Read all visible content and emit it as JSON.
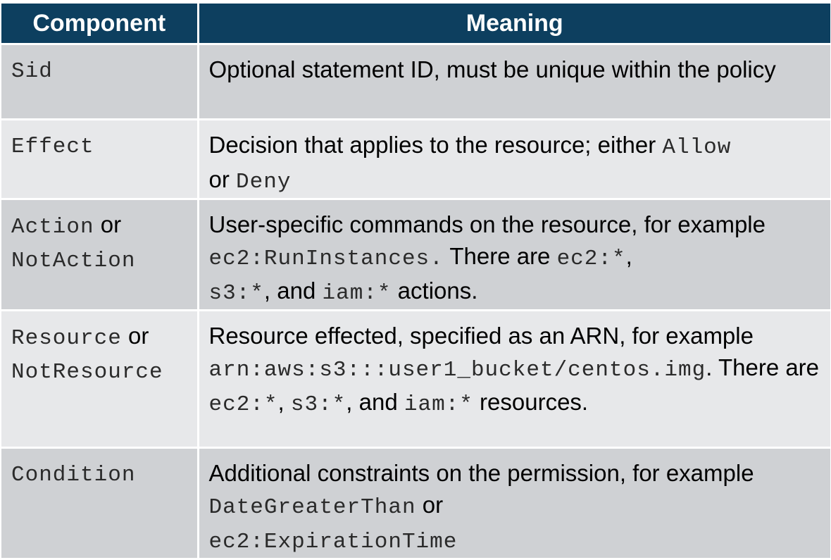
{
  "header": {
    "component": "Component",
    "meaning": "Meaning"
  },
  "rows": [
    {
      "component": {
        "code1": "Sid"
      },
      "meaning": {
        "t1": "Optional statement ID, must be unique within the policy"
      }
    },
    {
      "component": {
        "code1": "Effect"
      },
      "meaning": {
        "t1": "Decision that applies to the resource; either ",
        "c1": "Allow",
        "t2": " or ",
        "c2": "Deny"
      }
    },
    {
      "component": {
        "code1": "Action",
        "or": " or",
        "code2": "NotAction"
      },
      "meaning": {
        "t1": "User-specific commands on the resource, for example ",
        "c1": "ec2:RunInstances.",
        "t2": " There are ",
        "c2": "ec2:*",
        "t3": ", ",
        "c3": "s3:*",
        "t4": ", and ",
        "c4": "iam:*",
        "t5": " actions."
      }
    },
    {
      "component": {
        "code1": "Resource",
        "or": " or",
        "code2": "NotResource"
      },
      "meaning": {
        "t1": "Resource effected, specified as an ARN, for example ",
        "c1": "arn:aws:s3:::user1_bucket/centos.img",
        "t2": ". There are ",
        "c2": "ec2:*",
        "t3": ", ",
        "c3": "s3:*",
        "t4": ", and ",
        "c4": "iam:*",
        "t5": " resources."
      }
    },
    {
      "component": {
        "code1": "Condition"
      },
      "meaning": {
        "t1": "Additional constraints on the permission, for example ",
        "c1": "DateGreaterThan",
        "t2": " or ",
        "c2": "ec2:ExpirationTime"
      }
    }
  ]
}
